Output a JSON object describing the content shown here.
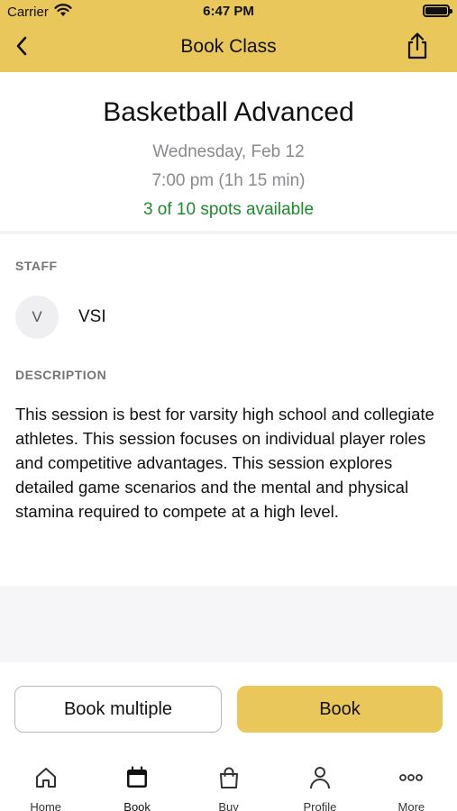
{
  "status_bar": {
    "carrier": "Carrier",
    "time": "6:47 PM"
  },
  "nav": {
    "title": "Book Class",
    "back_icon": "chevron-left-icon",
    "share_icon": "share-icon"
  },
  "class_info": {
    "name": "Basketball Advanced",
    "date": "Wednesday, Feb 12",
    "time": "7:00 pm (1h 15 min)",
    "spots": "3 of 10 spots available"
  },
  "staff": {
    "label": "STAFF",
    "initial": "V",
    "name": "VSI"
  },
  "description": {
    "label": "DESCRIPTION",
    "text": "This session is best for varsity high school and collegiate athletes. This session focuses on individual player roles and competitive advantages. This session explores detailed game scenarios and the mental and physical stamina required to compete at a high level."
  },
  "actions": {
    "book_multiple": "Book multiple",
    "book": "Book"
  },
  "tabs": [
    {
      "label": "Home",
      "icon": "home-icon"
    },
    {
      "label": "Book",
      "icon": "calendar-icon",
      "active": true
    },
    {
      "label": "Buy",
      "icon": "shopping-bag-icon"
    },
    {
      "label": "Profile",
      "icon": "person-icon"
    },
    {
      "label": "More",
      "icon": "more-icon"
    }
  ],
  "colors": {
    "accent": "#eac75a",
    "spots": "#1d8a2c",
    "muted": "#8a8a8e"
  }
}
